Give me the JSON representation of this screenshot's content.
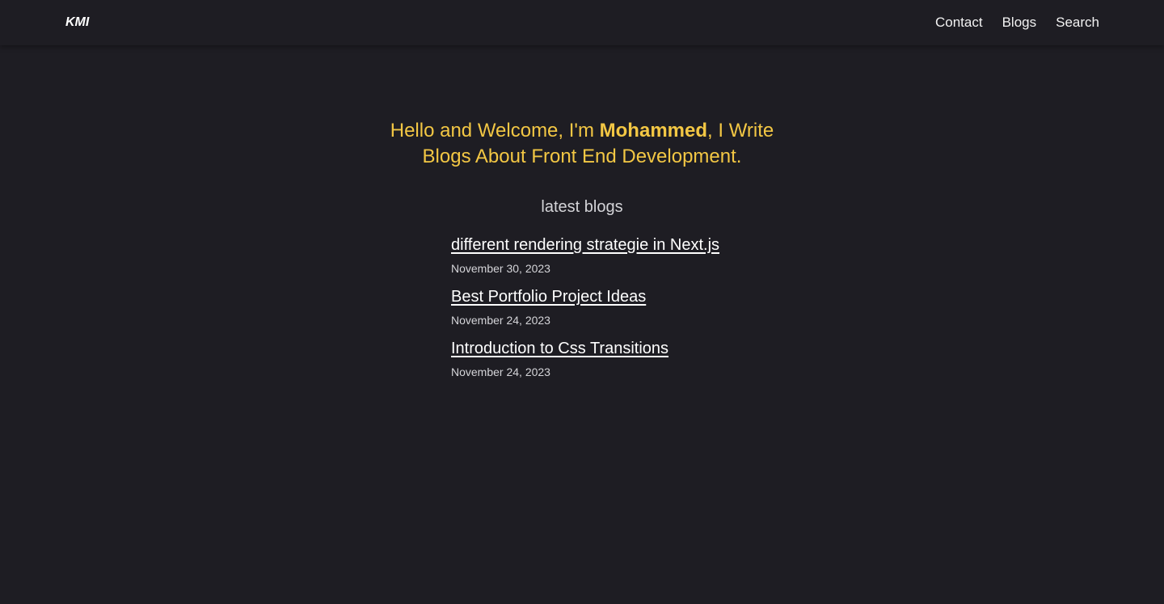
{
  "header": {
    "logo": "KMI",
    "nav": [
      {
        "label": "Contact"
      },
      {
        "label": "Blogs"
      },
      {
        "label": "Search"
      }
    ]
  },
  "hero": {
    "text_before": "Hello and Welcome, I'm ",
    "name": "Mohammed",
    "text_after": ", I Write Blogs About Front End Development."
  },
  "latest": {
    "heading": "latest blogs",
    "posts": [
      {
        "title": "different rendering strategie in Next.js",
        "date": "November 30, 2023"
      },
      {
        "title": "Best Portfolio Project Ideas",
        "date": "November 24, 2023"
      },
      {
        "title": "Introduction to Css Transitions",
        "date": "November 24, 2023"
      }
    ]
  },
  "colors": {
    "background": "#1e1d23",
    "accent": "#f3c744",
    "text": "#ffffff",
    "muted": "#d4d4d8"
  }
}
